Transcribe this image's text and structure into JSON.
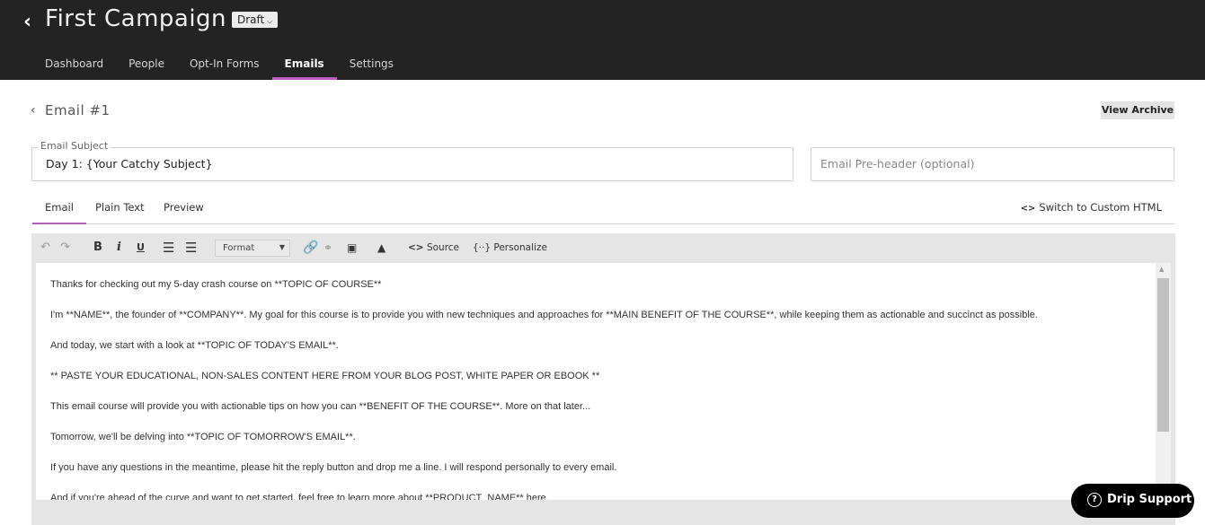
{
  "header": {
    "back_icon": "chevron-left",
    "campaign_title": "First Campaign",
    "status": "Draft",
    "status_chevron": "⌄"
  },
  "nav": {
    "items": [
      {
        "label": "Dashboard",
        "active": false
      },
      {
        "label": "People",
        "active": false
      },
      {
        "label": "Opt-In Forms",
        "active": false
      },
      {
        "label": "Emails",
        "active": true
      },
      {
        "label": "Settings",
        "active": false
      }
    ]
  },
  "email": {
    "back_icon": "chevron-left",
    "title": "Email #1",
    "view_archive_label": "View Archive",
    "subject_label": "Email Subject",
    "subject_value": "Day 1: {Your Catchy Subject}",
    "preheader_placeholder": "Email Pre-header (optional)",
    "preheader_value": ""
  },
  "editor_tabs": {
    "items": [
      {
        "label": "Email",
        "active": true
      },
      {
        "label": "Plain Text",
        "active": false
      },
      {
        "label": "Preview",
        "active": false
      }
    ],
    "switch_html_label": "Switch to Custom HTML"
  },
  "toolbar": {
    "undo_icon": "undo",
    "redo_icon": "redo",
    "bold_label": "B",
    "italic_label": "i",
    "underline_label": "U",
    "bulleted_list_icon": "bulleted-list",
    "numbered_list_icon": "numbered-list",
    "format_label": "Format",
    "link_icon": "link",
    "unlink_icon": "unlink",
    "quote_icon": "block-quote",
    "image_icon": "image",
    "source_label": "Source",
    "personalize_label": "Personalize"
  },
  "content": {
    "paragraphs": [
      "Thanks for checking out my 5-day crash course on **TOPIC OF COURSE**",
      "I'm **NAME**, the founder of **COMPANY**. My goal for this course is to provide you with new techniques and approaches for **MAIN BENEFIT OF THE COURSE**, while keeping them as actionable and succinct as possible.",
      "And today, we start with a look at **TOPIC OF TODAY'S EMAIL**.",
      "** PASTE YOUR EDUCATIONAL, NON-SALES CONTENT HERE FROM YOUR BLOG POST, WHITE PAPER OR EBOOK **",
      "This email course will provide you with actionable tips on how you can **BENEFIT OF THE COURSE**. More on that later...",
      "Tomorrow, we'll be delving into **TOPIC OF TOMORROW'S EMAIL**.",
      "If you have any questions in the meantime, please hit the reply button and drop me a line. I will respond personally to every email.",
      "And if you're ahead of the curve and want to get started, feel free to learn more about **PRODUCT_NAME** here."
    ]
  },
  "support": {
    "label": "Drip Support",
    "icon": "?"
  },
  "colors": {
    "header_bg": "#232323",
    "accent": "#c25cc6",
    "toolbar_bg": "#e5e5e5"
  }
}
